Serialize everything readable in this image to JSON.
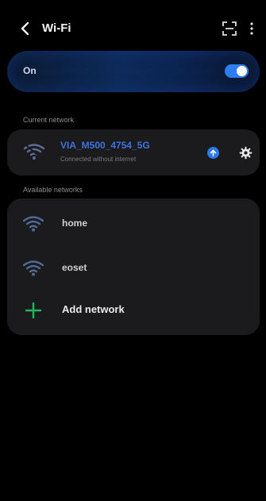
{
  "header": {
    "title": "Wi-Fi"
  },
  "toggle": {
    "label": "On",
    "state": "on",
    "accent": "#2e7ef2"
  },
  "current": {
    "section_label": "Current network",
    "network_name": "VIA_M500_4754_5G",
    "status": "Connected without internet"
  },
  "available": {
    "section_label": "Available networks",
    "networks": [
      {
        "label": "home"
      },
      {
        "label": "eoset"
      }
    ],
    "add_label": "Add network"
  },
  "icons": {
    "back": "chevron-left-icon",
    "scan": "qr-scan-icon",
    "more": "more-vertical-icon",
    "wifi": "wifi-icon",
    "upload": "upload-icon",
    "settings": "gear-icon",
    "add": "plus-icon"
  }
}
